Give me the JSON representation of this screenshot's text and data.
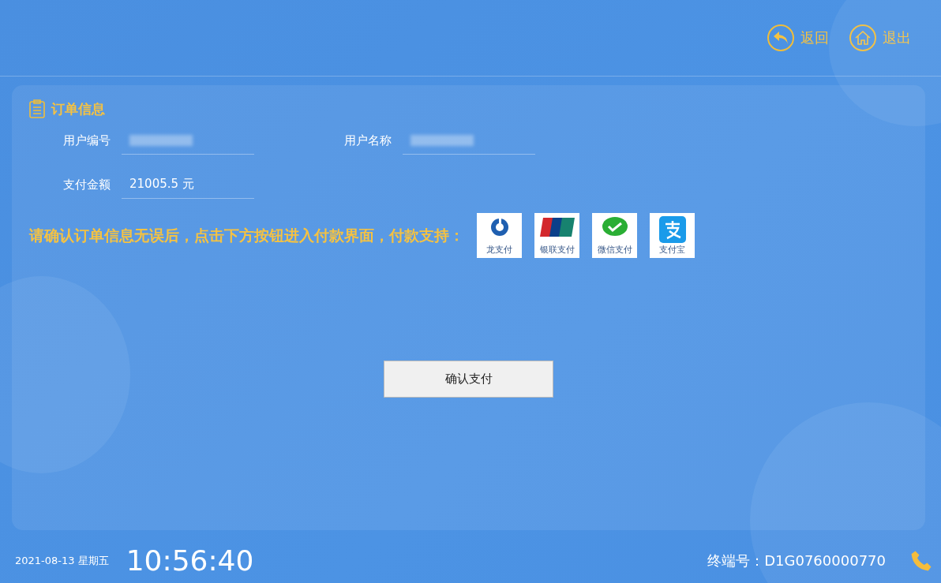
{
  "header": {
    "buttons": [
      {
        "kind": "back",
        "label": "返回"
      },
      {
        "kind": "home",
        "label": "退出"
      }
    ]
  },
  "order": {
    "title": "订单信息",
    "fields": [
      {
        "label": "用户编号",
        "redacted": true
      },
      {
        "label": "用户名称",
        "redacted": true
      },
      {
        "label": "支付金额",
        "value": "21005.5 元",
        "redacted": false
      }
    ],
    "notice": "请确认订单信息无误后，点击下方按钮进入付款界面，付款支持：",
    "payments": [
      {
        "kind": "ccb",
        "label": "龙支付"
      },
      {
        "kind": "unionpay",
        "label": "银联支付"
      },
      {
        "kind": "wechat",
        "label": "微信支付"
      },
      {
        "kind": "alipay",
        "label": "支付宝"
      }
    ],
    "confirm_button": "确认支付"
  },
  "footer": {
    "date": "2021-08-13 星期五",
    "time": "10:56:40",
    "terminal_label": "终端号：",
    "terminal_id": "D1G0760000770"
  }
}
